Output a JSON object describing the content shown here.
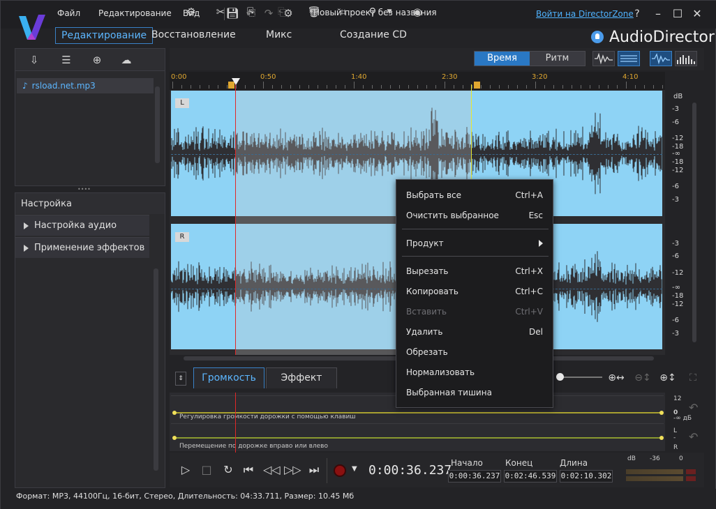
{
  "menu": {
    "file": "Файл",
    "edit": "Редактирование",
    "view": "Вид"
  },
  "project_title": "*Новый проект без названия",
  "login_link": "Войти на DirectorZone",
  "help": "?",
  "main_tabs": [
    "Редактирование",
    "Восстановление",
    "Микс",
    "Создание CD"
  ],
  "brand": "AudioDirector",
  "library": {
    "file": "rsload.net.mp3"
  },
  "settings": {
    "title": "Настройка",
    "items": [
      "Настройка аудио",
      "Применение эффектов"
    ]
  },
  "view_toggle": {
    "time": "Время",
    "beat": "Ритм"
  },
  "ruler": {
    "labels": [
      "0:00",
      "0:50",
      "1:40",
      "2:30",
      "3:20",
      "4:10"
    ]
  },
  "channels": {
    "left": "L",
    "right": "R"
  },
  "db_scale": {
    "unit": "dB",
    "left": [
      "-3",
      "-6",
      "-12",
      "-18",
      "-∞",
      "-18",
      "-12",
      "-6",
      "-3"
    ],
    "right": [
      "-3",
      "-6",
      "-12",
      "-∞",
      "-18",
      "-12",
      "-6",
      "-3"
    ]
  },
  "lower_tabs": {
    "volume": "Громкость",
    "effect": "Эффект"
  },
  "lanes": {
    "volume_text": "Регулировка громкости дорожки с помощью клавиш",
    "pan_text": "Перемещение по дорожке вправо или влево",
    "vol_db": {
      "top": "12",
      "mid": "0",
      "bottom": "-∞ дБ"
    },
    "pan": {
      "left": "L",
      "center": "-",
      "right": "R"
    }
  },
  "transport": {
    "time": "0:00:36.237",
    "start_label": "Начало",
    "end_label": "Конец",
    "length_label": "Длина",
    "start": "0:00:36.237",
    "end": "0:02:46.539",
    "length": "0:02:10.302"
  },
  "meter": {
    "db": "dB",
    "m36": "-36",
    "zero": "0"
  },
  "status": "Формат: MP3, 44100Гц, 16-бит, Стерео, Длительность: 04:33.711, Размер: 10.45 Мб",
  "context_menu": [
    {
      "label": "Выбрать все",
      "shortcut": "Ctrl+A"
    },
    {
      "label": "Очистить выбранное",
      "shortcut": "Esc"
    },
    {
      "label": "Продукт",
      "shortcut": ""
    },
    {
      "label": "Вырезать",
      "shortcut": "Ctrl+X"
    },
    {
      "label": "Копировать",
      "shortcut": "Ctrl+C"
    },
    {
      "label": "Вставить",
      "shortcut": "Ctrl+V"
    },
    {
      "label": "Удалить",
      "shortcut": "Del"
    },
    {
      "label": "Обрезать",
      "shortcut": ""
    },
    {
      "label": "Нормализовать",
      "shortcut": ""
    },
    {
      "label": "Выбранная тишина",
      "shortcut": ""
    }
  ],
  "colors": {
    "accent": "#2a78c4",
    "waveform_bg": "#8ed3f5",
    "waveform": "#2f2f33",
    "playhead": "#e02828",
    "selection_end": "#e8e830"
  }
}
